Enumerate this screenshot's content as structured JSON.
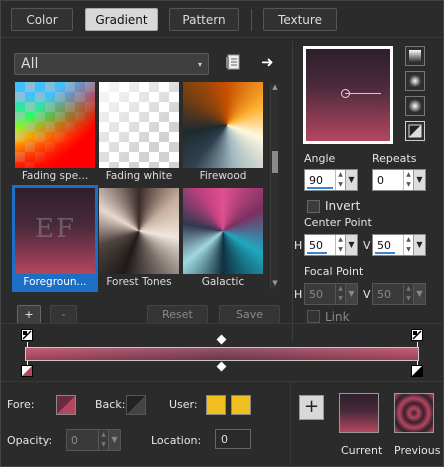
{
  "tabs": [
    {
      "label": "Color",
      "active": false
    },
    {
      "label": "Gradient",
      "active": true
    },
    {
      "label": "Pattern",
      "active": false
    },
    {
      "label": "Texture",
      "active": false
    }
  ],
  "category": {
    "selected": "All"
  },
  "thumbnails": [
    {
      "label": "Fading spe...",
      "selected": false
    },
    {
      "label": "Fading white",
      "selected": false
    },
    {
      "label": "Firewood",
      "selected": false
    },
    {
      "label": "Foregroun...",
      "selected": true,
      "overlay_text": "EF"
    },
    {
      "label": "Forest Tones",
      "selected": false
    },
    {
      "label": "Galactic",
      "selected": false
    }
  ],
  "list_buttons": {
    "add": "+",
    "remove": "-",
    "reset": "Reset",
    "save": "Save"
  },
  "settings": {
    "angle_label": "Angle",
    "angle": "90",
    "repeats_label": "Repeats",
    "repeats": "0",
    "invert_label": "Invert",
    "center_label": "Center Point",
    "center_h_label": "H",
    "center_h": "50",
    "center_v_label": "V",
    "center_v": "50",
    "focal_label": "Focal Point",
    "focal_h_label": "H",
    "focal_h": "50",
    "focal_v_label": "V",
    "focal_v": "50",
    "link_label": "Link"
  },
  "bottom": {
    "fore_label": "Fore:",
    "back_label": "Back:",
    "user_label": "User:",
    "opacity_label": "Opacity:",
    "opacity": "0",
    "location_label": "Location:",
    "location": "0",
    "add_button": "+",
    "current_label": "Current",
    "previous_label": "Previous"
  },
  "colors": {
    "fore": "#2f1f2b",
    "back": "#b4465f",
    "user": "#f0be1e",
    "accent": "#3a84d8",
    "selected_tile_bg": "#1b6fc4"
  }
}
